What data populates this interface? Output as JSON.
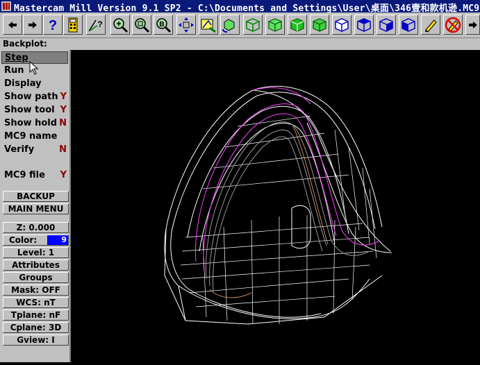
{
  "window": {
    "title": "Mastercam Mill Version 9.1 SP2 - C:\\Documents and Settings\\User\\桌面\\346壹和款机逊.MC9"
  },
  "toolbar": {
    "buttons": [
      {
        "name": "back-arrow-icon"
      },
      {
        "name": "forward-arrow-icon"
      },
      {
        "name": "help-icon"
      },
      {
        "name": "calculator-icon"
      },
      {
        "name": "analyze-icon"
      },
      {
        "name": "zoom-icon"
      },
      {
        "name": "unzoom-icon"
      },
      {
        "name": "zoom-box-icon"
      },
      {
        "name": "pan-icon"
      },
      {
        "name": "screen-icon"
      },
      {
        "name": "rotate-icon"
      },
      {
        "name": "view-iso-icon"
      },
      {
        "name": "view-front-icon"
      },
      {
        "name": "view-top-icon"
      },
      {
        "name": "view-side-icon"
      },
      {
        "name": "cube-iso-icon"
      },
      {
        "name": "cube-top-icon"
      },
      {
        "name": "cube-right-icon"
      },
      {
        "name": "cube-front-icon"
      },
      {
        "name": "pencil-icon"
      },
      {
        "name": "no-delete-icon"
      },
      {
        "name": "next-page-icon"
      }
    ]
  },
  "backplot": {
    "label": "Backplot:"
  },
  "menu": {
    "items": [
      {
        "label": "Step",
        "flag": ""
      },
      {
        "label": "Run",
        "flag": ""
      },
      {
        "label": "Display",
        "flag": ""
      },
      {
        "label": "Show path",
        "flag": "Y"
      },
      {
        "label": "Show tool",
        "flag": "Y"
      },
      {
        "label": "Show hold",
        "flag": "N"
      },
      {
        "label": "MC9 name",
        "flag": ""
      },
      {
        "label": "Verify",
        "flag": "N"
      },
      {
        "label": "MC9 file",
        "flag": "Y"
      }
    ],
    "backup": "BACKUP",
    "main_menu": "MAIN MENU"
  },
  "status": {
    "z": "Z:  0.000",
    "color_label": "Color:",
    "color_value": "9",
    "level": "Level:  1",
    "attributes": "Attributes",
    "groups": "Groups",
    "mask": "Mask:  OFF",
    "wcs": "WCS:  nT",
    "tplane": "Tplane:  nF",
    "cplane": "Cplane: 3D",
    "gview": "Gview:  I"
  },
  "colors": {
    "titlebar": "#0a1a7a",
    "panel": "#c0c0c0",
    "viewport_bg": "#000000",
    "wire": "#ffffff",
    "path_magenta": "#ff40ff",
    "path_gray": "#9a9a9a",
    "path_orange": "#ffaa66",
    "menu_flag": "#8b0000",
    "color_swatch": "#0000ff"
  }
}
